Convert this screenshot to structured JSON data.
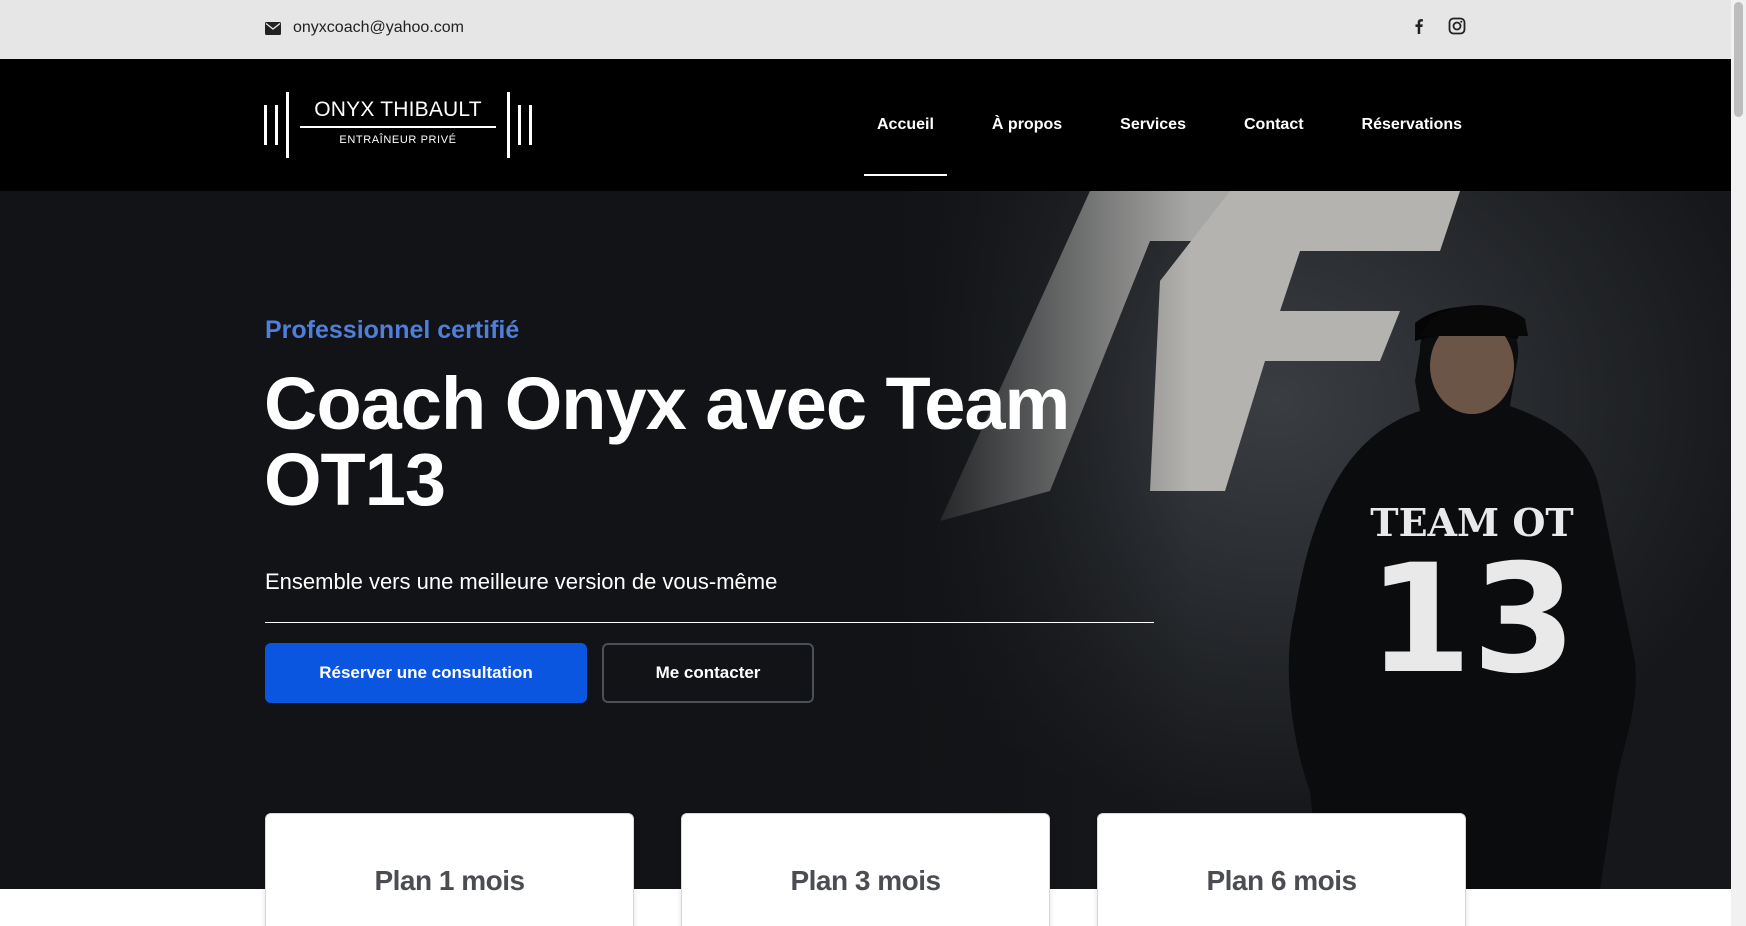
{
  "topbar": {
    "email": "onyxcoach@yahoo.com",
    "email_icon": "envelope-icon",
    "social": [
      "facebook-icon",
      "instagram-icon"
    ]
  },
  "logo": {
    "name": "ONYX THIBAULT",
    "subtitle": "ENTRAÎNEUR PRIVÉ"
  },
  "nav": {
    "items": [
      {
        "label": "Accueil",
        "active": true
      },
      {
        "label": "À propos",
        "active": false
      },
      {
        "label": "Services",
        "active": false
      },
      {
        "label": "Contact",
        "active": false
      },
      {
        "label": "Réservations",
        "active": false
      }
    ]
  },
  "hero": {
    "eyebrow": "Professionnel certifié",
    "headline": "Coach Onyx avec Team OT13",
    "tagline": "Ensemble vers une meilleure version de vous-même",
    "primary_button": "Réserver une consultation",
    "secondary_button": "Me contacter",
    "shirt_text": "TEAM OT",
    "shirt_number": "13"
  },
  "plans": [
    {
      "title": "Plan 1 mois"
    },
    {
      "title": "Plan 3 mois"
    },
    {
      "title": "Plan 6 mois"
    }
  ],
  "colors": {
    "accent": "#0a56e0",
    "eyebrow": "#4f7fd8",
    "hero_bg": "#111316",
    "header_bg": "#000000",
    "topbar_bg": "#e6e6e6"
  }
}
